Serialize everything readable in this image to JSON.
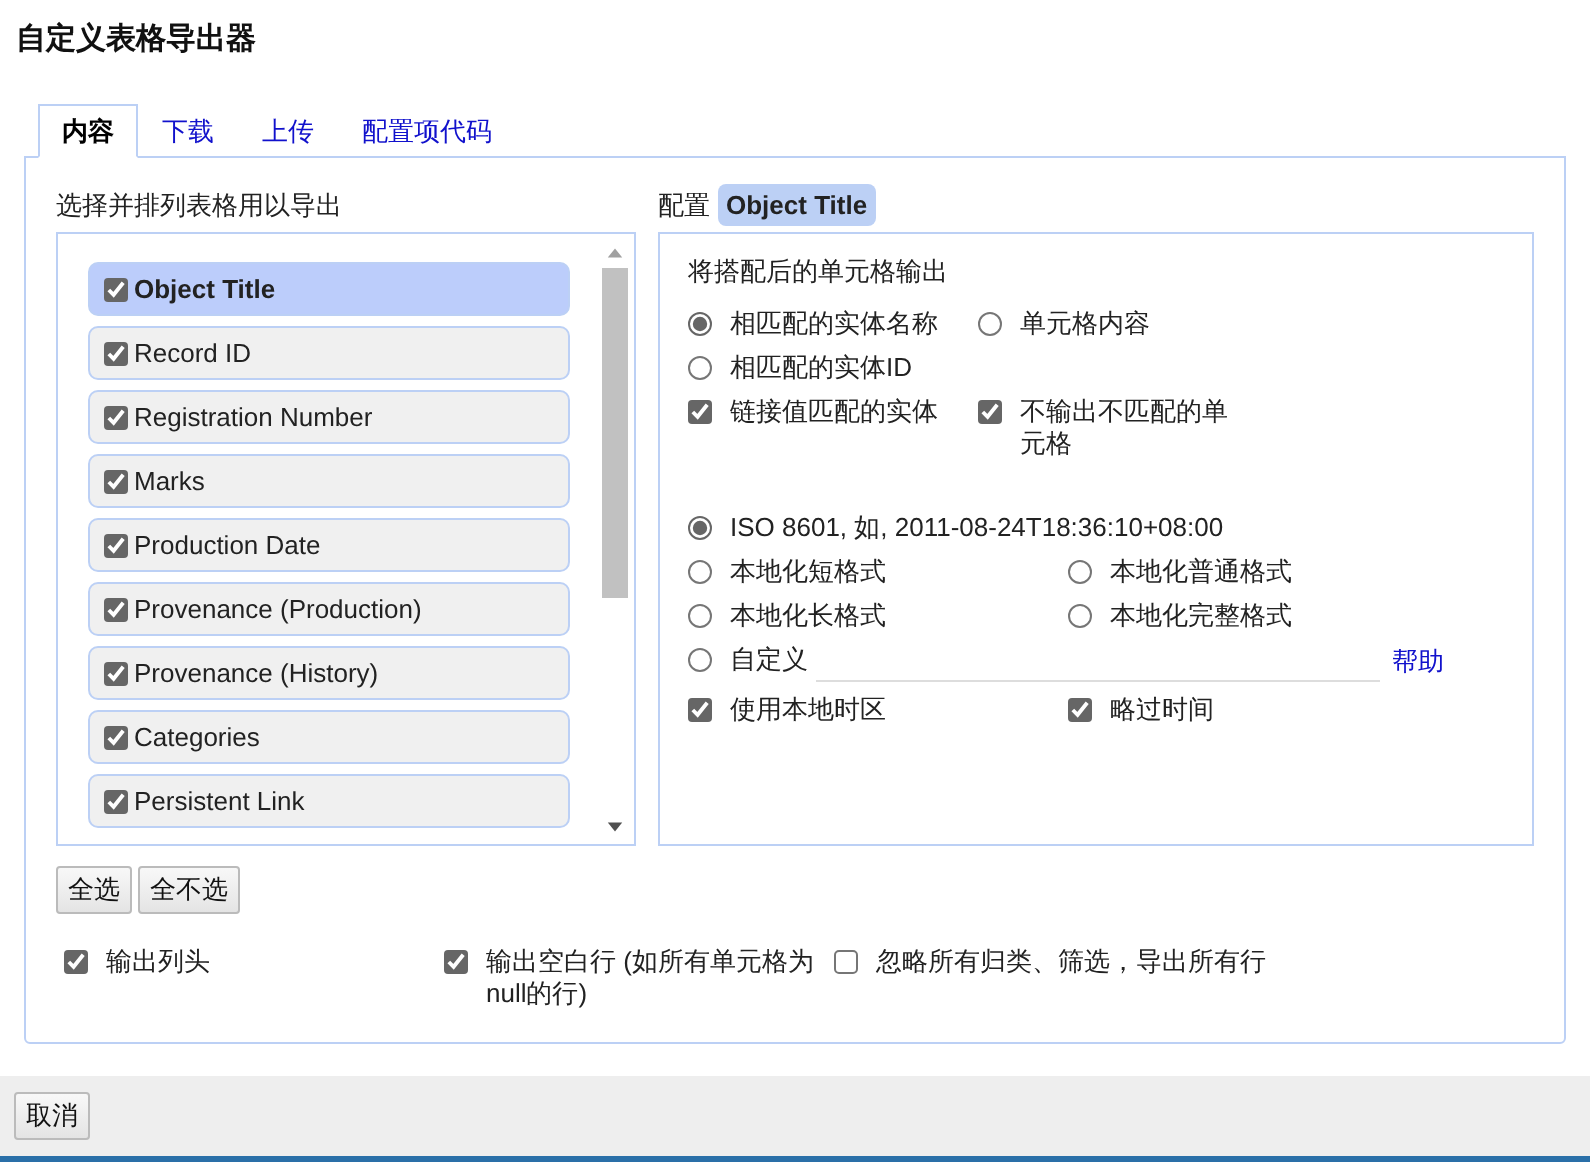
{
  "window": {
    "title": "自定义表格导出器"
  },
  "tabs": [
    {
      "label": "内容",
      "selected": true
    },
    {
      "label": "下载",
      "selected": false
    },
    {
      "label": "上传",
      "selected": false
    },
    {
      "label": "配置项代码",
      "selected": false
    }
  ],
  "columns_heading": "选择并排列表格用以导出",
  "columns": [
    {
      "label": "Object Title",
      "checked": true,
      "highlighted": true
    },
    {
      "label": "Record ID",
      "checked": true,
      "highlighted": false
    },
    {
      "label": "Registration Number",
      "checked": true,
      "highlighted": false
    },
    {
      "label": "Marks",
      "checked": true,
      "highlighted": false
    },
    {
      "label": "Production Date",
      "checked": true,
      "highlighted": false
    },
    {
      "label": "Provenance (Production)",
      "checked": true,
      "highlighted": false
    },
    {
      "label": "Provenance (History)",
      "checked": true,
      "highlighted": false
    },
    {
      "label": "Categories",
      "checked": true,
      "highlighted": false
    },
    {
      "label": "Persistent Link",
      "checked": true,
      "highlighted": false
    }
  ],
  "list_buttons": [
    "全选",
    "全不选"
  ],
  "config": {
    "label": "配置",
    "column": "Object Title",
    "heading": "将搭配后的单元格输出",
    "cell_options": [
      {
        "kind": "radio",
        "label": "相匹配的实体名称",
        "selected": true
      },
      {
        "kind": "radio",
        "label": "单元格内容",
        "selected": false
      },
      {
        "kind": "radio",
        "label": "相匹配的实体ID",
        "selected": false
      },
      {
        "kind": "blank"
      },
      {
        "kind": "checkbox",
        "label": "链接值匹配的实体",
        "checked": true
      },
      {
        "kind": "checkbox",
        "label": "不输出不匹配的单元格",
        "checked": true
      }
    ],
    "date_options": [
      {
        "kind": "radio",
        "label": "ISO 8601, 如, 2011-08-24T18:36:10+08:00",
        "selected": true
      },
      {
        "kind": "radio",
        "label": "本地化短格式",
        "selected": false
      },
      {
        "kind": "radio",
        "label": "本地化普通格式",
        "selected": false
      },
      {
        "kind": "radio",
        "label": "本地化长格式",
        "selected": false
      },
      {
        "kind": "radio",
        "label": "本地化完整格式",
        "selected": false
      }
    ],
    "custom": {
      "label": "自定义",
      "selected": false,
      "help": "帮助"
    },
    "time_options": [
      {
        "kind": "checkbox",
        "label": "使用本地时区",
        "checked": true
      },
      {
        "kind": "checkbox",
        "label": "略过时间",
        "checked": true
      }
    ]
  },
  "output_options": [
    {
      "label": "输出列头",
      "checked": true
    },
    {
      "label": "输出空白行 (如所有单元格为null的行)",
      "checked": true
    },
    {
      "label": "忽略所有归类、筛选，导出所有行",
      "checked": false
    }
  ],
  "footer_button": "取消"
}
